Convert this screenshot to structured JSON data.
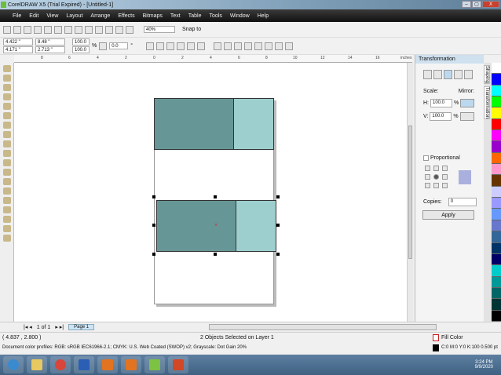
{
  "window": {
    "title": "CorelDRAW X5 (Trial Expired) - [Untitled-1]",
    "min": "–",
    "max": "▢",
    "close": "X"
  },
  "menu": [
    "File",
    "Edit",
    "View",
    "Layout",
    "Arrange",
    "Effects",
    "Bitmaps",
    "Text",
    "Table",
    "Tools",
    "Window",
    "Help"
  ],
  "toolbar": {
    "zoom": "40%",
    "snap": "Snap to"
  },
  "props": {
    "x": "4.422 \"",
    "y": "4.171 \"",
    "w": "8.48 \"",
    "h": "2.713 \"",
    "sx": "100.0",
    "sy": "100.0",
    "pct": "%",
    "rot": "0.0",
    "deg": "°"
  },
  "ruler": {
    "unit": "inches",
    "ticks": [
      "8",
      "6",
      "4",
      "2",
      "0",
      "2",
      "4",
      "6",
      "8",
      "10",
      "12",
      "14",
      "16"
    ]
  },
  "docker": {
    "title": "Transformation",
    "scale": "Scale:",
    "mirror": "Mirror:",
    "h_label": "H:",
    "h": "100.0",
    "v_label": "V:",
    "v": "100.0",
    "pct": "%",
    "proportional": "Proportional",
    "copies_label": "Copies:",
    "copies": "0",
    "apply": "Apply"
  },
  "tabs": [
    "Shaping",
    "Transformation"
  ],
  "palette": [
    "#ffffff",
    "#0000ff",
    "#00ffff",
    "#00ff00",
    "#ffff00",
    "#ff0000",
    "#ff00ff",
    "#9900cc",
    "#ff6600",
    "#ff99cc",
    "#663300",
    "#ccccff",
    "#9999ff",
    "#6699ff",
    "#6677cc",
    "#336699",
    "#003366",
    "#000066",
    "#00cccc",
    "#009999",
    "#006666",
    "#003333",
    "#000000"
  ],
  "pagebar": {
    "count": "1 of 1",
    "page": "Page 1"
  },
  "status": {
    "coords": "( 4.837 , 2.800 )",
    "selection": "2 Objects Selected on Layer 1",
    "fill": "Fill Color",
    "profile": "Document color profiles: RGB: sRGB IEC61966-2.1; CMYK: U.S. Web Coated (SWOP) v2; Grayscale: Dot Gain 20%",
    "outline": "C:0 M:0 Y:0 K:100  0.500 pt"
  },
  "taskbar": {
    "time": "3:24 PM",
    "date": "9/9/2020"
  }
}
